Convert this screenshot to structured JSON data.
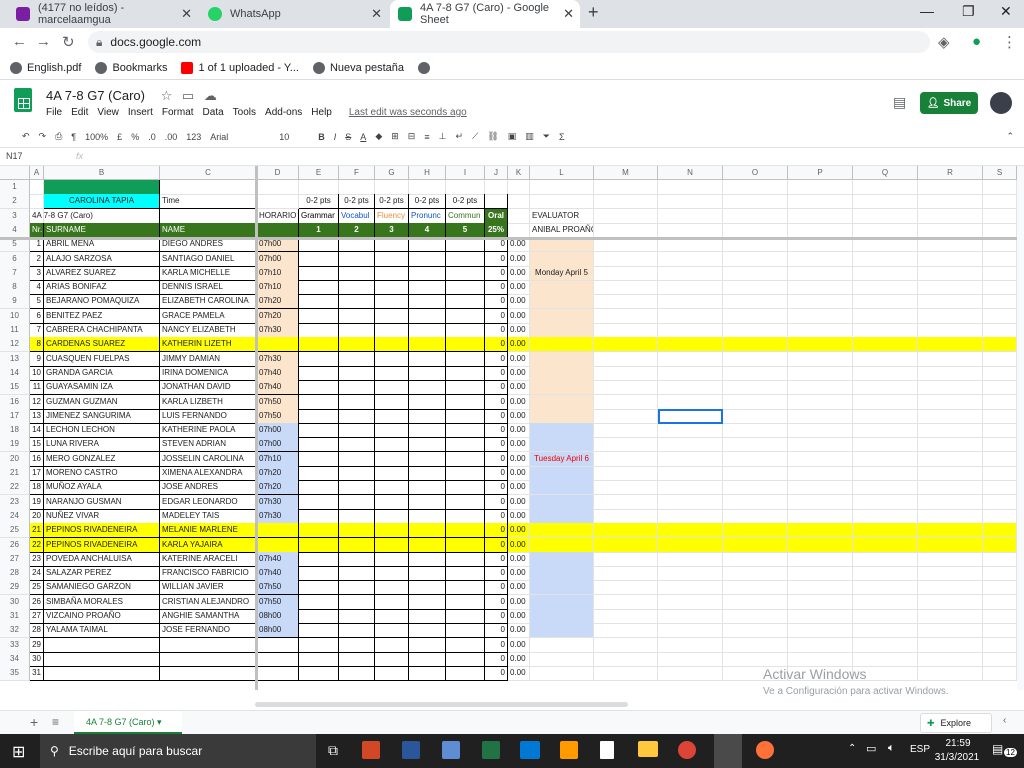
{
  "browser": {
    "tabs": [
      {
        "label": "(4177 no leídos) - marcelaamgua",
        "icon_color": "#7b1fa2"
      },
      {
        "label": "WhatsApp",
        "icon_color": "#25d366"
      },
      {
        "label": "4A 7-8 G7 (Caro) - Google Sheet",
        "icon_color": "#0f9d58"
      }
    ],
    "url": "docs.google.com",
    "bookmarks": [
      "English.pdf",
      "Bookmarks",
      "1 of 1 uploaded - Y...",
      "Nueva pestaña"
    ]
  },
  "app": {
    "title": "4A 7-8 G7 (Caro)",
    "menus": [
      "File",
      "Edit",
      "View",
      "Insert",
      "Format",
      "Data",
      "Tools",
      "Add-ons",
      "Help"
    ],
    "last_edit": "Last edit was seconds ago",
    "share_label": "Share",
    "toolbar": {
      "zoom": "100%",
      "currency": "£",
      "percent": "%",
      "dec0": ".0",
      "dec2": ".00",
      "format": "123",
      "font": "Arial",
      "size": "10"
    },
    "name_box": "N17",
    "fx": "fx",
    "sheet_tab": "4A 7-8 G7 (Caro)",
    "explore": "Explore"
  },
  "columns": [
    "A",
    "B",
    "C",
    "D",
    "E",
    "F",
    "G",
    "H",
    "I",
    "J",
    "K",
    "L",
    "M",
    "N",
    "O",
    "P",
    "Q",
    "R",
    "S"
  ],
  "row_numbers": [
    "1",
    "2",
    "3",
    "4",
    "5",
    "6",
    "7",
    "8",
    "9",
    "10",
    "11",
    "12",
    "13",
    "14",
    "15",
    "16",
    "17",
    "18",
    "19",
    "20",
    "21",
    "22",
    "23",
    "24",
    "25",
    "26",
    "27",
    "28",
    "29",
    "30",
    "31",
    "32",
    "33",
    "34",
    "35"
  ],
  "header": {
    "teacher": "CAROLINA TAPIA",
    "time": "Time",
    "group": "4A 7-8 G7 (Caro)",
    "horario": "HORARIO",
    "pts": [
      "0-2 pts",
      "0-2 pts",
      "0-2 pts",
      "0-2 pts",
      "0-2 pts"
    ],
    "criteria": [
      "Grammar",
      "Vocabul",
      "Fluency",
      "Pronunc",
      "Commun",
      "Oral"
    ],
    "numbers": [
      "1",
      "2",
      "3",
      "4",
      "5",
      "25%"
    ],
    "nr": "Nr.",
    "surname": "SURNAME",
    "name": "NAME",
    "evaluator": "EVALUATOR",
    "evaluator_name": "ANIBAL PROAÑO",
    "monday": "Monday April 5",
    "tuesday": "Tuesday April 6"
  },
  "students": [
    {
      "n": "1",
      "surname": "ABRIL MENA",
      "name": "DIEGO ANDRES",
      "time": "07h00",
      "total": "0",
      "score": "0.00"
    },
    {
      "n": "2",
      "surname": "ALAJO SARZOSA",
      "name": "SANTIAGO DANIEL",
      "time": "07h00",
      "total": "0",
      "score": "0.00"
    },
    {
      "n": "3",
      "surname": "ALVAREZ SUAREZ",
      "name": "KARLA MICHELLE",
      "time": "07h10",
      "total": "0",
      "score": "0.00"
    },
    {
      "n": "4",
      "surname": "ARIAS BONIFAZ",
      "name": "DENNIS ISRAEL",
      "time": "07h10",
      "total": "0",
      "score": "0.00"
    },
    {
      "n": "5",
      "surname": "BEJARANO POMAQUIZA",
      "name": "ELIZABETH CAROLINA",
      "time": "07h20",
      "total": "0",
      "score": "0.00"
    },
    {
      "n": "6",
      "surname": "BENITEZ PAEZ",
      "name": "GRACE PAMELA",
      "time": "07h20",
      "total": "0",
      "score": "0.00"
    },
    {
      "n": "7",
      "surname": "CABRERA CHACHIPANTA",
      "name": "NANCY ELIZABETH",
      "time": "07h30",
      "total": "0",
      "score": "0.00"
    },
    {
      "n": "8",
      "surname": "CARDENAS SUAREZ",
      "name": "KATHERIN LIZETH",
      "time": "",
      "total": "0",
      "score": "0.00",
      "hl": true
    },
    {
      "n": "9",
      "surname": "CUASQUEN FUELPAS",
      "name": "JIMMY DAMIAN",
      "time": "07h30",
      "total": "0",
      "score": "0.00"
    },
    {
      "n": "10",
      "surname": "GRANDA GARCIA",
      "name": "IRINA DOMENICA",
      "time": "07h40",
      "total": "0",
      "score": "0.00"
    },
    {
      "n": "11",
      "surname": "GUAYASAMIN IZA",
      "name": "JONATHAN DAVID",
      "time": "07h40",
      "total": "0",
      "score": "0.00"
    },
    {
      "n": "12",
      "surname": "GUZMAN GUZMAN",
      "name": "KARLA LIZBETH",
      "time": "07h50",
      "total": "0",
      "score": "0.00"
    },
    {
      "n": "13",
      "surname": "JIMENEZ SANGURIMA",
      "name": "LUIS FERNANDO",
      "time": "07h50",
      "total": "0",
      "score": "0.00"
    },
    {
      "n": "14",
      "surname": "LECHON LECHON",
      "name": "KATHERINE PAOLA",
      "time": "07h00",
      "total": "0",
      "score": "0.00"
    },
    {
      "n": "15",
      "surname": "LUNA RIVERA",
      "name": "STEVEN ADRIAN",
      "time": "07h00",
      "total": "0",
      "score": "0.00"
    },
    {
      "n": "16",
      "surname": "MERO GONZALEZ",
      "name": "JOSSELIN CAROLINA",
      "time": "07h10",
      "total": "0",
      "score": "0.00"
    },
    {
      "n": "17",
      "surname": "MORENO CASTRO",
      "name": "XIMENA ALEXANDRA",
      "time": "07h20",
      "total": "0",
      "score": "0.00"
    },
    {
      "n": "18",
      "surname": "MUÑOZ AYALA",
      "name": "JOSE ANDRES",
      "time": "07h20",
      "total": "0",
      "score": "0.00"
    },
    {
      "n": "19",
      "surname": "NARANJO GUSMAN",
      "name": "EDGAR LEONARDO",
      "time": "07h30",
      "total": "0",
      "score": "0.00"
    },
    {
      "n": "20",
      "surname": "NUÑEZ VIVAR",
      "name": "MADELEY TAIS",
      "time": "07h30",
      "total": "0",
      "score": "0.00"
    },
    {
      "n": "21",
      "surname": "PEPINOS RIVADENEIRA",
      "name": "MELANIE MARLENE",
      "time": "",
      "total": "0",
      "score": "0.00",
      "hl": true
    },
    {
      "n": "22",
      "surname": "PEPINOS RIVADENEIRA",
      "name": "KARLA YAJAIRA",
      "time": "",
      "total": "0",
      "score": "0.00",
      "hl": true
    },
    {
      "n": "23",
      "surname": "POVEDA ANCHALUISA",
      "name": "KATERINE ARACELI",
      "time": "07h40",
      "total": "0",
      "score": "0.00"
    },
    {
      "n": "24",
      "surname": "SALAZAR PEREZ",
      "name": "FRANCISCO FABRICIO",
      "time": "07h40",
      "total": "0",
      "score": "0.00"
    },
    {
      "n": "25",
      "surname": "SAMANIEGO GARZON",
      "name": "WILLIAN JAVIER",
      "time": "07h50",
      "total": "0",
      "score": "0.00"
    },
    {
      "n": "26",
      "surname": "SIMBAÑA MORALES",
      "name": "CRISTIAN ALEJANDRO",
      "time": "07h50",
      "total": "0",
      "score": "0.00"
    },
    {
      "n": "27",
      "surname": "VIZCAINO PROAÑO",
      "name": "ANGHIE SAMANTHA",
      "time": "08h00",
      "total": "0",
      "score": "0.00"
    },
    {
      "n": "28",
      "surname": "YALAMA TAIMAL",
      "name": "JOSE FERNANDO",
      "time": "08h00",
      "total": "0",
      "score": "0.00"
    },
    {
      "n": "29",
      "surname": "",
      "name": "",
      "time": "",
      "total": "0",
      "score": "0.00"
    },
    {
      "n": "30",
      "surname": "",
      "name": "",
      "time": "",
      "total": "0",
      "score": "0.00"
    },
    {
      "n": "31",
      "surname": "",
      "name": "",
      "time": "",
      "total": "0",
      "score": "0.00"
    }
  ],
  "watermark": {
    "title": "Activar Windows",
    "subtitle": "Ve a Configuración para activar Windows."
  },
  "taskbar": {
    "search": "Escribe aquí para buscar",
    "lang": "ESP",
    "time": "21:59",
    "date": "31/3/2021",
    "notif": "12"
  },
  "colors": {
    "green": "#0f9d58",
    "yellow": "#ffff00",
    "cyan": "#00ffff",
    "peach": "#fce5cd",
    "blue": "#c9daf8",
    "darkgreen": "#38761d",
    "share": "#188038"
  }
}
